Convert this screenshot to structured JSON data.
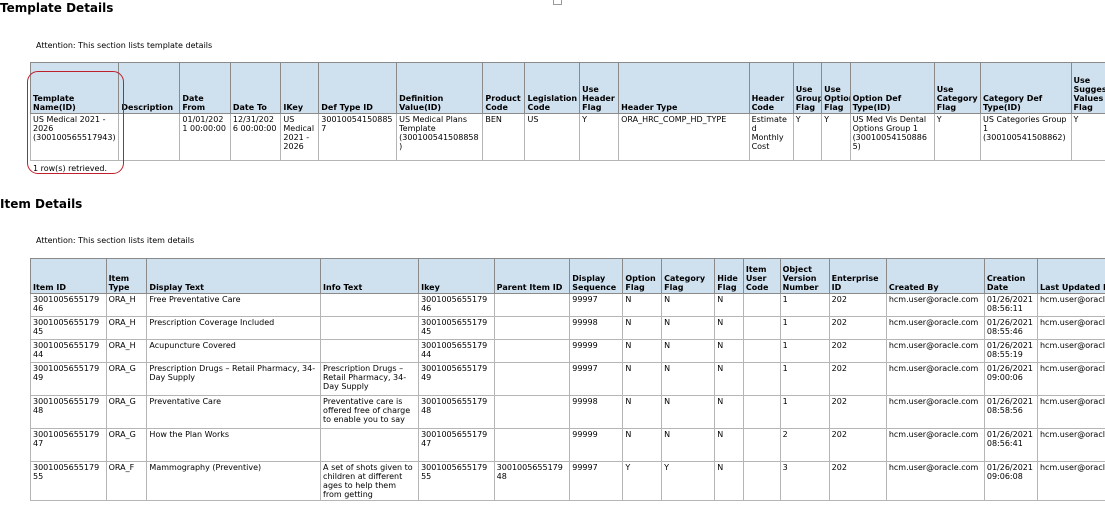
{
  "template_section": {
    "title": "Template Details",
    "attention": "Attention: This section lists template details",
    "columns": [
      "Template Name(ID)",
      "Description",
      "Date From",
      "Date To",
      "IKey",
      "Def Type ID",
      "Definition Value(ID)",
      "Product Code",
      "Legislation Code",
      "Use Header Flag",
      "Header Type",
      "Header Code",
      "Use Groups Flag",
      "Use Option Flag",
      "Option Def Type(ID)",
      "Use Category Flag",
      "Category Def Type(ID)",
      "Use Suggested Values Flag"
    ],
    "rows": [
      [
        "US Medical 2021 - 2026 (300100565517943)",
        "",
        "01/01/2021 00:00:00",
        "12/31/2026 00:00:00",
        "US Medical 2021 - 2026",
        "300100541508857",
        "US Medical Plans Template (300100541508858)",
        "BEN",
        "US",
        "Y",
        "ORA_HRC_COMP_HD_TYPE",
        "Estimated Monthly Cost",
        "Y",
        "Y",
        "US Med Vis Dental Options Group 1 (300100541508865)",
        "Y",
        "US Categories Group 1 (300100541508862)",
        "Y"
      ]
    ],
    "retrieved": "1 row(s) retrieved."
  },
  "item_section": {
    "title": "Item Details",
    "attention": "Attention: This section lists item details",
    "columns": [
      "Item ID",
      "Item Type",
      "Display Text",
      "Info Text",
      "Ikey",
      "Parent Item ID",
      "Display Sequence",
      "Option Flag",
      "Category Flag",
      "Hide Flag",
      "Item User Code",
      "Object Version Number",
      "Enterprise ID",
      "Created By",
      "Creation Date",
      "Last Updated By"
    ],
    "rows": [
      [
        "300100565517946",
        "ORA_H",
        "Free Preventative Care",
        "",
        "300100565517946",
        "",
        "99997",
        "N",
        "N",
        "N",
        "",
        "1",
        "202",
        "hcm.user@oracle.com",
        "01/26/2021 08:56:11",
        "hcm.user@oracle.co"
      ],
      [
        "300100565517945",
        "ORA_H",
        "Prescription Coverage Included",
        "",
        "300100565517945",
        "",
        "99998",
        "N",
        "N",
        "N",
        "",
        "1",
        "202",
        "hcm.user@oracle.com",
        "01/26/2021 08:55:46",
        "hcm.user@oracle.co"
      ],
      [
        "300100565517944",
        "ORA_H",
        "Acupuncture Covered",
        "",
        "300100565517944",
        "",
        "99999",
        "N",
        "N",
        "N",
        "",
        "1",
        "202",
        "hcm.user@oracle.com",
        "01/26/2021 08:55:19",
        "hcm.user@oracle.co"
      ],
      [
        "300100565517949",
        "ORA_G",
        "Prescription Drugs – Retail Pharmacy, 34-Day Supply",
        "Prescription Drugs – Retail Pharmacy, 34-Day Supply",
        "300100565517949",
        "",
        "99997",
        "N",
        "N",
        "N",
        "",
        "1",
        "202",
        "hcm.user@oracle.com",
        "01/26/2021 09:00:06",
        "hcm.user@oracle.co"
      ],
      [
        "300100565517948",
        "ORA_G",
        "Preventative Care",
        "Preventative care is offered free of charge to enable you to say",
        "300100565517948",
        "",
        "99998",
        "N",
        "N",
        "N",
        "",
        "1",
        "202",
        "hcm.user@oracle.com",
        "01/26/2021 08:58:56",
        "hcm.user@oracle.co"
      ],
      [
        "300100565517947",
        "ORA_G",
        "How the Plan Works",
        "",
        "300100565517947",
        "",
        "99999",
        "N",
        "N",
        "N",
        "",
        "2",
        "202",
        "hcm.user@oracle.com",
        "01/26/2021 08:56:41",
        "hcm.user@oracle.co"
      ],
      [
        "300100565517955",
        "ORA_F",
        "Mammography (Preventive)",
        "A set of shots given to children at different ages to help them from getting",
        "300100565517955",
        "300100565517948",
        "99997",
        "Y",
        "Y",
        "N",
        "",
        "3",
        "202",
        "hcm.user@oracle.com",
        "01/26/2021 09:06:08",
        "hcm.user@oracle.co"
      ]
    ]
  }
}
